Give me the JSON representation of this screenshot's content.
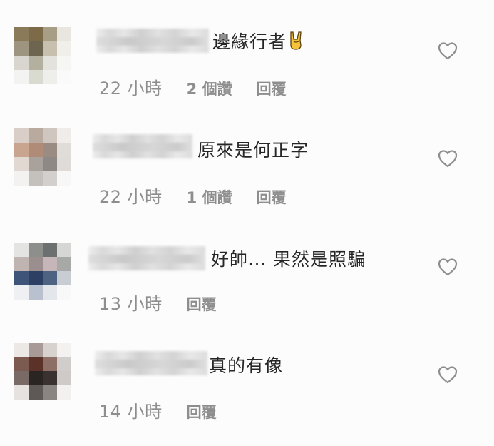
{
  "comments": [
    {
      "text": "邊緣行者",
      "emoji": "horns-gesture",
      "time": "22 小時",
      "likes": "2 個讚",
      "reply": "回覆"
    },
    {
      "text": "原來是何正字",
      "time": "22 小時",
      "likes": "1 個讚",
      "reply": "回覆"
    },
    {
      "text": "好帥… 果然是照騙",
      "time": "13 小時",
      "likes": "",
      "reply": "回覆"
    },
    {
      "text": "真的有像",
      "time": "14 小時",
      "likes": "",
      "reply": "回覆"
    }
  ],
  "colors": {
    "meta_text": "#8e8e8e",
    "body_text": "#262626",
    "heart_outline": "#8e8e8e"
  },
  "icons": {
    "like": "heart-outline-icon",
    "emoji": "sign-of-the-horns-emoji"
  }
}
